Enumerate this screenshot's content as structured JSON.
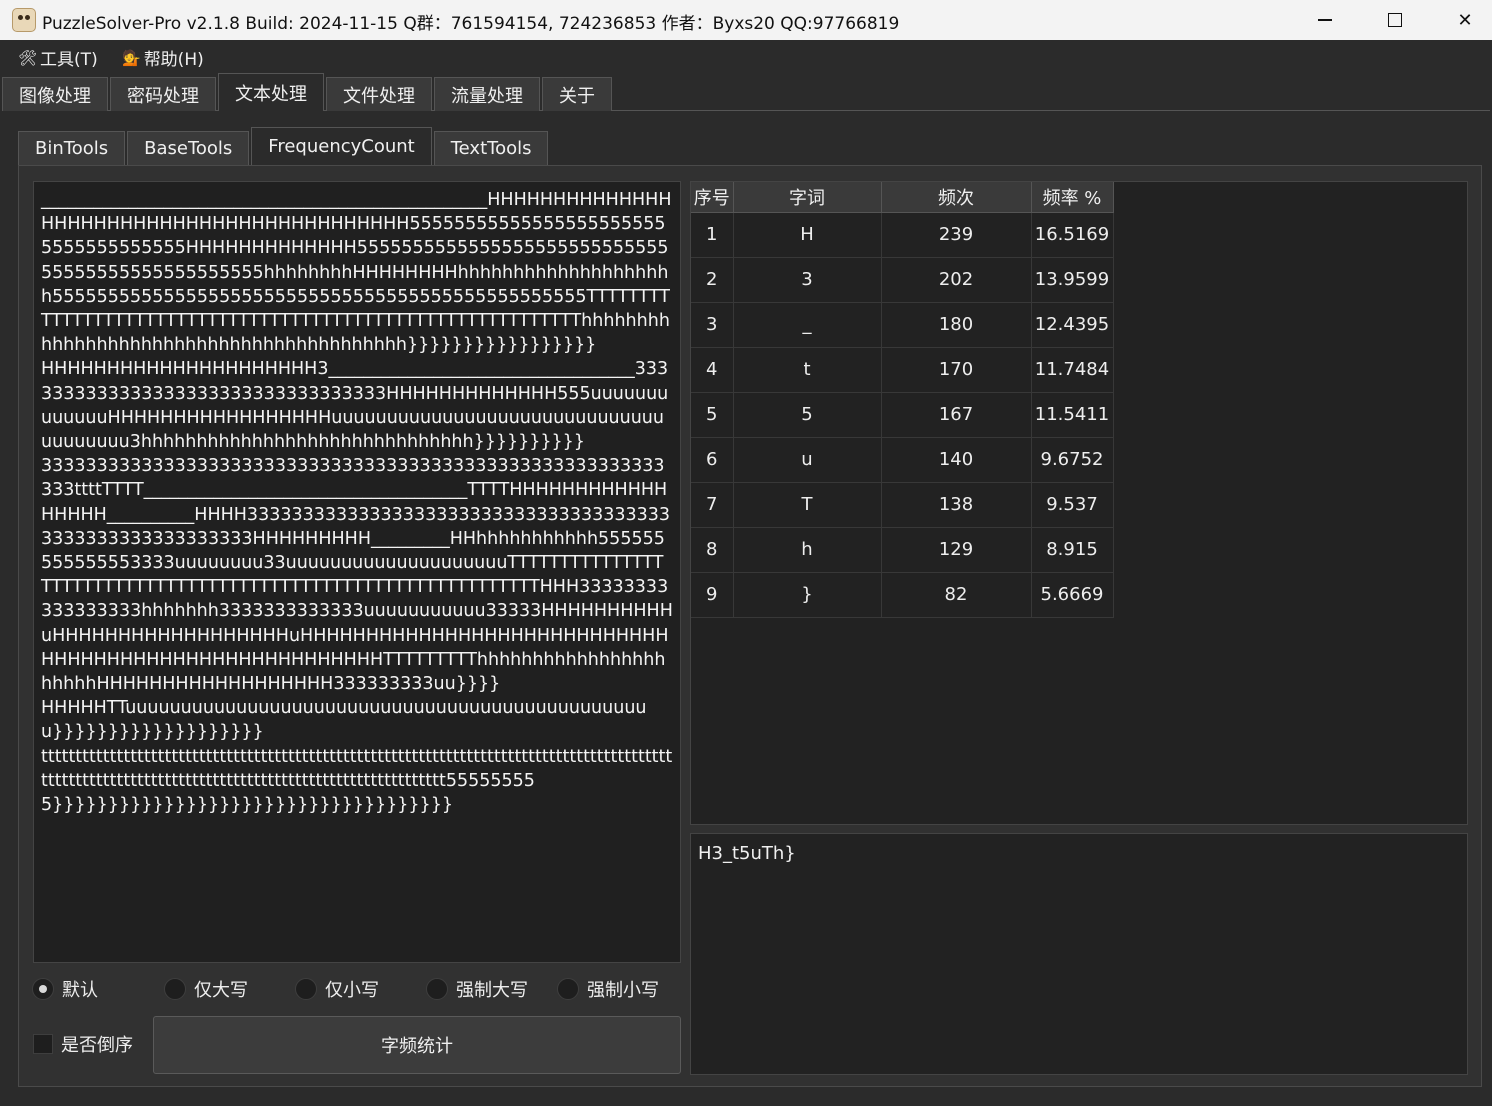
{
  "window": {
    "title": "PuzzleSolver-Pro v2.1.8  Build: 2024-11-15  Q群：761594154, 724236853  作者：Byxs20  QQ:97766819"
  },
  "menu": {
    "tools": "工具(T)",
    "help": "帮助(H)"
  },
  "main_tabs": [
    "图像处理",
    "密码处理",
    "文本处理",
    "文件处理",
    "流量处理",
    "关于"
  ],
  "sub_tabs": [
    "BinTools",
    "BaseTools",
    "FrequencyCount",
    "TextTools"
  ],
  "input_text": "___________________________________________________HHHHHHHHHHHHHHHHHHHHHHHHHHHHHHHHHHHHHHHHHH555555555555555555555555555555555555HHHHHHHHHHHHH555555555555555555555555555555555555555555555555hhhhhhhhHHHHHHHHhhhhhhhhhhhhhhhhhhhh555555555555555555555555555555555555555555555555TTTTTTTTTTTTTTTTTTTTTTTTTTTTTTTTTTTTTTTTTTTTTTTTTTTTTTTTTTTThhhhhhhhhhhhhhhhhhhhhhhhhhhhhhhhhhhhhhhhh}}}}}}}}}}}}}}}}}\nHHHHHHHHHHHHHHHHHHHHH3___________________________________3333333333333333333333333333333333HHHHHHHHHHHHH555uuuuuuuuuuuuuHHHHHHHHHHHHHHHHHuuuuuuuuuuuuuuuuuuuuuuuuuuuuuuuuuuuuuu3hhhhhhhhhhhhhhhhhhhhhhhhhhhhhh}}}}}}}}}}\n33333333333333333333333333333333333333333333333333333333333ttttTTTT_____________________________________TTTTHHHHHHHHHHHHHHHHH__________HHHH333333333333333333333333333333333333333333333333333333333HHHHHHHHH_________HHhhhhhhhhhhh555555555555553333uuuuuuuu33uuuuuuuuuuuuuuuuuuuuTTTTTTTTTTTTTTTTTTTTTTTTTTTTTTTTTTTTTTTTTTTTTTTTTTTTTTTTTTTTTTTHHH33333333333333333hhhhhhh3333333333333uuuuuuuuuuu33333HHHHHHHHHHuHHHHHHHHHHHHHHHHHHuHHHHHHHHHHHHHHHHHHHHHHHHHHHHHHHHHHHHHHHHHHHHHHHHHHHHHHTTTTTTTTThhhhhhhhhhhhhhhhhhhhhhHHHHHHHHHHHHHHHHHH333333333uu}}}}\nHHHHHTTuuuuuuuuuuuuuuuuuuuuuuuuuuuuuuuuuuuuuuuuuuuuuuuu}}}}}}}}}}}}}}}}}}}\nttttttttttttttttttttttttttttttttttttttttttttttttttttttttttttttttttttttttttttttttttttttttttttttttttttttttttttttttttttttttttttttttttttttttttttttttttttttt555555555}}}}}}}}}}}}}}}}}}}}}}}}}}}}}}}}}}}}",
  "table": {
    "headers": [
      "序号",
      "字词",
      "频次",
      "频率 %"
    ],
    "rows": [
      [
        "1",
        "H",
        "239",
        "16.5169"
      ],
      [
        "2",
        "3",
        "202",
        "13.9599"
      ],
      [
        "3",
        "_",
        "180",
        "12.4395"
      ],
      [
        "4",
        "t",
        "170",
        "11.7484"
      ],
      [
        "5",
        "5",
        "167",
        "11.5411"
      ],
      [
        "6",
        "u",
        "140",
        "9.6752"
      ],
      [
        "7",
        "T",
        "138",
        "9.537"
      ],
      [
        "8",
        "h",
        "129",
        "8.915"
      ],
      [
        "9",
        "}",
        "82",
        "5.6669"
      ]
    ]
  },
  "result_text": "H3_t5uTh}",
  "options": {
    "default": "默认",
    "upper_only": "仅大写",
    "lower_only": "仅小写",
    "force_upper": "强制大写",
    "force_lower": "强制小写",
    "reverse": "是否倒序",
    "count_button": "字频统计"
  }
}
